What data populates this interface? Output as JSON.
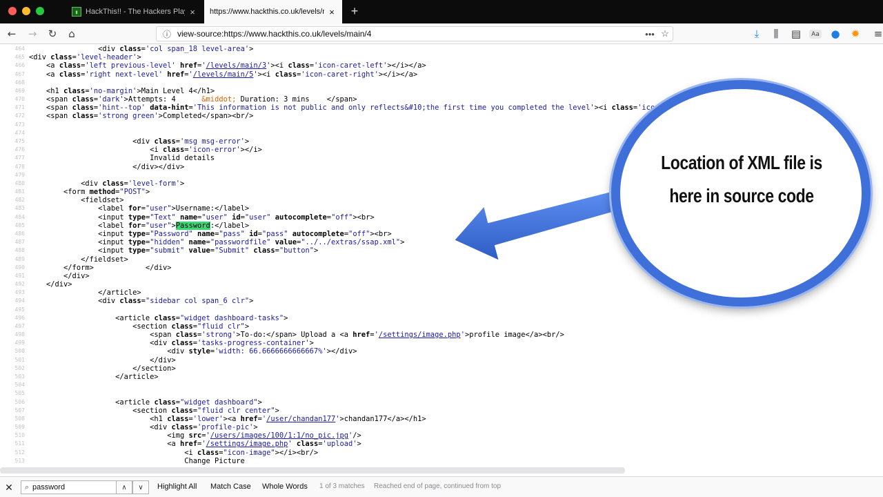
{
  "window": {
    "tabs": [
      {
        "title": "HackThis!! - The Hackers Playg",
        "favicon": "ht-favicon-icon",
        "active": false
      },
      {
        "title": "https://www.hackthis.co.uk/levels/m",
        "active": true
      }
    ],
    "new_tab": "+"
  },
  "nav": {
    "url": "view-source:https://www.hackthis.co.uk/levels/main/4",
    "page_actions": "•••"
  },
  "source": {
    "lines": [
      {
        "ln": "464",
        "html": "                <span class='tg'>&lt;div</span> <span class='at'>class</span>=<span class='av'>'col span_18 level-area'</span><span class='tg'>&gt;</span>"
      },
      {
        "ln": "465",
        "html": "<span class='tg'>&lt;div</span> <span class='at'>class</span>=<span class='av'>'level-header'</span><span class='tg'>&gt;</span>"
      },
      {
        "ln": "466",
        "html": "    <span class='tg'>&lt;a</span> <span class='at'>class</span>=<span class='av'>'left previous-level'</span> <span class='at'>href</span>=<span class='av'>'</span><span class='lnk'>/levels/main/3</span><span class='av'>'</span><span class='tg'>&gt;&lt;i</span> <span class='at'>class</span>=<span class='av'>'icon-caret-left'</span><span class='tg'>&gt;&lt;/i&gt;&lt;/a&gt;</span>"
      },
      {
        "ln": "467",
        "html": "    <span class='tg'>&lt;a</span> <span class='at'>class</span>=<span class='av'>'right next-level'</span> <span class='at'>href</span>=<span class='av'>'</span><span class='lnk'>/levels/main/5</span><span class='av'>'</span><span class='tg'>&gt;&lt;i</span> <span class='at'>class</span>=<span class='av'>'icon-caret-right'</span><span class='tg'>&gt;&lt;/i&gt;&lt;/a&gt;</span>"
      },
      {
        "ln": "468",
        "html": ""
      },
      {
        "ln": "469",
        "html": "    <span class='tg'>&lt;h1</span> <span class='at'>class</span>=<span class='av'>'no-margin'</span><span class='tg'>&gt;</span>Main Level 4<span class='tg'>&lt;/h1&gt;</span>"
      },
      {
        "ln": "470",
        "html": "    <span class='tg'>&lt;span</span> <span class='at'>class</span>=<span class='av'>'dark'</span><span class='tg'>&gt;</span>Attempts: 4      <span class='en'>&amp;middot;</span> Duration: 3 mins    <span class='tg'>&lt;/span&gt;</span>"
      },
      {
        "ln": "471",
        "html": "    <span class='tg'>&lt;span</span> <span class='at'>class</span>=<span class='av'>'hint--top'</span> <span class='at'>data-hint</span>=<span class='av'>'This information is not public and only reflects&amp;#10;the first time you completed the level'</span><span class='tg'>&gt;&lt;i</span> <span class='at'>class</span>=<span class='av'>'icon-info'</span><span class='tg'>&gt;&lt;/i&gt;&lt;/span&gt;&lt;br/&gt;</span>"
      },
      {
        "ln": "472",
        "html": "    <span class='tg'>&lt;span</span> <span class='at'>class</span>=<span class='av'>'strong green'</span><span class='tg'>&gt;</span>Completed<span class='tg'>&lt;/span&gt;&lt;br/&gt;</span>"
      },
      {
        "ln": "473",
        "html": ""
      },
      {
        "ln": "474",
        "html": ""
      },
      {
        "ln": "475",
        "html": "                        <span class='tg'>&lt;div</span> <span class='at'>class</span>=<span class='av'>'msg msg-error'</span><span class='tg'>&gt;</span>"
      },
      {
        "ln": "476",
        "html": "                            <span class='tg'>&lt;i</span> <span class='at'>class</span>=<span class='av'>'icon-error'</span><span class='tg'>&gt;&lt;/i&gt;</span>"
      },
      {
        "ln": "477",
        "html": "                            Invalid details"
      },
      {
        "ln": "478",
        "html": "                        <span class='tg'>&lt;/div&gt;&lt;/div&gt;</span>"
      },
      {
        "ln": "479",
        "html": ""
      },
      {
        "ln": "480",
        "html": "            <span class='tg'>&lt;div</span> <span class='at'>class</span>=<span class='av'>'level-form'</span><span class='tg'>&gt;</span>"
      },
      {
        "ln": "481",
        "html": "        <span class='tg'>&lt;form</span> <span class='at'>method</span>=<span class='av'>\"POST\"</span><span class='tg'>&gt;</span>"
      },
      {
        "ln": "482",
        "html": "            <span class='tg'>&lt;fieldset&gt;</span>"
      },
      {
        "ln": "483",
        "html": "                <span class='tg'>&lt;label</span> <span class='at'>for</span>=<span class='av'>\"user\"</span><span class='tg'>&gt;</span>Username:<span class='tg'>&lt;/label&gt;</span>"
      },
      {
        "ln": "484",
        "html": "                <span class='tg'>&lt;input</span> <span class='at'>type</span>=<span class='av'>\"Text\"</span> <span class='at'>name</span>=<span class='av'>\"user\"</span> <span class='at'>id</span>=<span class='av'>\"user\"</span> <span class='at'>autocomplete</span>=<span class='av'>\"off\"</span><span class='tg'>&gt;&lt;br&gt;</span>"
      },
      {
        "ln": "485",
        "html": "                <span class='tg'>&lt;label</span> <span class='at'>for</span>=<span class='av'>\"user\"</span><span class='tg'>&gt;</span><span class='hl'>Password</span>:<span class='tg'>&lt;/label&gt;</span>"
      },
      {
        "ln": "486",
        "html": "                <span class='tg'>&lt;input</span> <span class='at'>type</span>=<span class='av'>\"Password\"</span> <span class='at'>name</span>=<span class='av'>\"pass\"</span> <span class='at'>id</span>=<span class='av'>\"pass\"</span> <span class='at'>autocomplete</span>=<span class='av'>\"off\"</span><span class='tg'>&gt;&lt;br&gt;</span>"
      },
      {
        "ln": "487",
        "html": "                <span class='tg'>&lt;input</span> <span class='at'>type</span>=<span class='av'>\"hidden\"</span> <span class='at'>name</span>=<span class='av'>\"passwordfile\"</span> <span class='at'>value</span>=<span class='av'>\"../../extras/ssap.xml\"</span><span class='tg'>&gt;</span>"
      },
      {
        "ln": "488",
        "html": "                <span class='tg'>&lt;input</span> <span class='at'>type</span>=<span class='av'>\"submit\"</span> <span class='at'>value</span>=<span class='av'>\"Submit\"</span> <span class='at'>class</span>=<span class='av'>\"button\"</span><span class='tg'>&gt;</span>"
      },
      {
        "ln": "489",
        "html": "            <span class='tg'>&lt;/fieldset&gt;</span>"
      },
      {
        "ln": "490",
        "html": "        <span class='tg'>&lt;/form&gt;</span>            <span class='tg'>&lt;/div&gt;</span>"
      },
      {
        "ln": "491",
        "html": "        <span class='tg'>&lt;/div&gt;</span>"
      },
      {
        "ln": "492",
        "html": "    <span class='tg'>&lt;/div&gt;</span>"
      },
      {
        "ln": "493",
        "html": "                <span class='tg'>&lt;/article&gt;</span>"
      },
      {
        "ln": "494",
        "html": "                <span class='tg'>&lt;div</span> <span class='at'>class</span>=<span class='av'>\"sidebar col span_6 clr\"</span><span class='tg'>&gt;</span>"
      },
      {
        "ln": "495",
        "html": ""
      },
      {
        "ln": "496",
        "html": "                    <span class='tg'>&lt;article</span> <span class='at'>class</span>=<span class='av'>\"widget dashboard-tasks\"</span><span class='tg'>&gt;</span>"
      },
      {
        "ln": "497",
        "html": "                        <span class='tg'>&lt;section</span> <span class='at'>class</span>=<span class='av'>\"fluid clr\"</span><span class='tg'>&gt;</span>"
      },
      {
        "ln": "498",
        "html": "                            <span class='tg'>&lt;span</span> <span class='at'>class</span>=<span class='av'>'strong'</span><span class='tg'>&gt;</span>To-do:<span class='tg'>&lt;/span&gt;</span> Upload a <span class='tg'>&lt;a</span> <span class='at'>href</span>=<span class='av'>'</span><span class='lnk'>/settings/image.php</span><span class='av'>'</span><span class='tg'>&gt;</span>profile image<span class='tg'>&lt;/a&gt;&lt;br/&gt;</span>"
      },
      {
        "ln": "499",
        "html": "                            <span class='tg'>&lt;div</span> <span class='at'>class</span>=<span class='av'>'tasks-progress-container'</span><span class='tg'>&gt;</span>"
      },
      {
        "ln": "500",
        "html": "                                <span class='tg'>&lt;div</span> <span class='at'>style</span>=<span class='av'>'width: 66.6666666666667%'</span><span class='tg'>&gt;&lt;/div&gt;</span>"
      },
      {
        "ln": "501",
        "html": "                            <span class='tg'>&lt;/div&gt;</span>"
      },
      {
        "ln": "502",
        "html": "                        <span class='tg'>&lt;/section&gt;</span>"
      },
      {
        "ln": "503",
        "html": "                    <span class='tg'>&lt;/article&gt;</span>"
      },
      {
        "ln": "504",
        "html": ""
      },
      {
        "ln": "505",
        "html": ""
      },
      {
        "ln": "506",
        "html": "                    <span class='tg'>&lt;article</span> <span class='at'>class</span>=<span class='av'>\"widget dashboard\"</span><span class='tg'>&gt;</span>"
      },
      {
        "ln": "507",
        "html": "                        <span class='tg'>&lt;section</span> <span class='at'>class</span>=<span class='av'>\"fluid clr center\"</span><span class='tg'>&gt;</span>"
      },
      {
        "ln": "508",
        "html": "                            <span class='tg'>&lt;h1</span> <span class='at'>class</span>=<span class='av'>'lower'</span><span class='tg'>&gt;&lt;a</span> <span class='at'>href</span>=<span class='av'>'</span><span class='lnk'>/user/chandan177</span><span class='av'>'</span><span class='tg'>&gt;</span>chandan177<span class='tg'>&lt;/a&gt;&lt;/h1&gt;</span>"
      },
      {
        "ln": "509",
        "html": "                            <span class='tg'>&lt;div</span> <span class='at'>class</span>=<span class='av'>'profile-pic'</span><span class='tg'>&gt;</span>"
      },
      {
        "ln": "510",
        "html": "                                <span class='tg'>&lt;img</span> <span class='at'>src</span>=<span class='av'>'</span><span class='lnk'>/users/images/100/1:1/no_pic.jpg</span><span class='av'>'</span><span class='tg'>/&gt;</span>"
      },
      {
        "ln": "511",
        "html": "                                <span class='tg'>&lt;a</span> <span class='at'>href</span>=<span class='av'>'</span><span class='lnk'>/settings/image.php</span><span class='av'>'</span> <span class='at'>class</span>=<span class='av'>'upload'</span><span class='tg'>&gt;</span>"
      },
      {
        "ln": "512",
        "html": "                                    <span class='tg'>&lt;i</span> <span class='at'>class</span>=<span class='av'>\"icon-image\"</span><span class='tg'>&gt;&lt;/i&gt;&lt;br/&gt;</span>"
      },
      {
        "ln": "513",
        "html": "                                    Change Picture"
      }
    ]
  },
  "callout": {
    "line1": "Location of XML file is",
    "line2": "here in source code",
    "ring_color": "#3f6fd9",
    "arrow_color": "#3f6fd9"
  },
  "findbar": {
    "query": "password",
    "highlight_all": "Highlight All",
    "match_case": "Match Case",
    "whole_words": "Whole Words",
    "matches": "1 of 3 matches",
    "status": "Reached end of page, continued from top"
  },
  "colors": {
    "link": "#1a1aa6",
    "match_highlight": "#38d878",
    "entity": "#e66000"
  }
}
